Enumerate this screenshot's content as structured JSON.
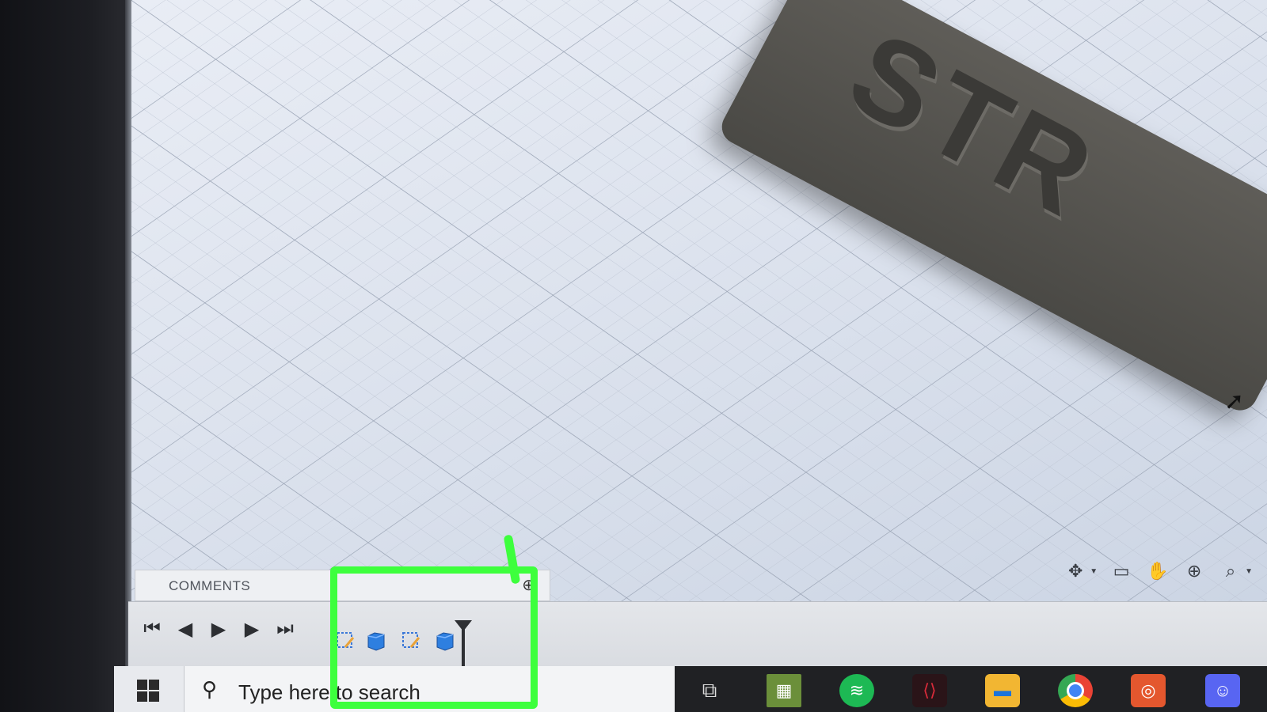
{
  "viewport": {
    "model_text": "STR"
  },
  "comments_panel": {
    "label": "COMMENTS",
    "add_icon": "plus-icon"
  },
  "navigation_toolbar": {
    "tools": [
      "orbit-icon",
      "look-at-icon",
      "pan-icon",
      "zoom-icon",
      "fit-icon"
    ]
  },
  "timeline": {
    "controls": [
      "skip-to-start",
      "step-back",
      "play",
      "step-forward",
      "skip-to-end"
    ],
    "features": [
      "sketch-icon",
      "extrude-body-icon",
      "sketch-icon",
      "extrude-body-icon"
    ]
  },
  "taskbar": {
    "search_placeholder": "Type here to search",
    "apps": [
      "task-view",
      "minecraft",
      "spotify",
      "acer-predator",
      "file-explorer",
      "chrome",
      "instagram",
      "discord"
    ]
  },
  "colors": {
    "highlight": "#3dff3d",
    "spotify": "#1db954",
    "discord": "#5865f2",
    "instagram": "#e4572e"
  }
}
